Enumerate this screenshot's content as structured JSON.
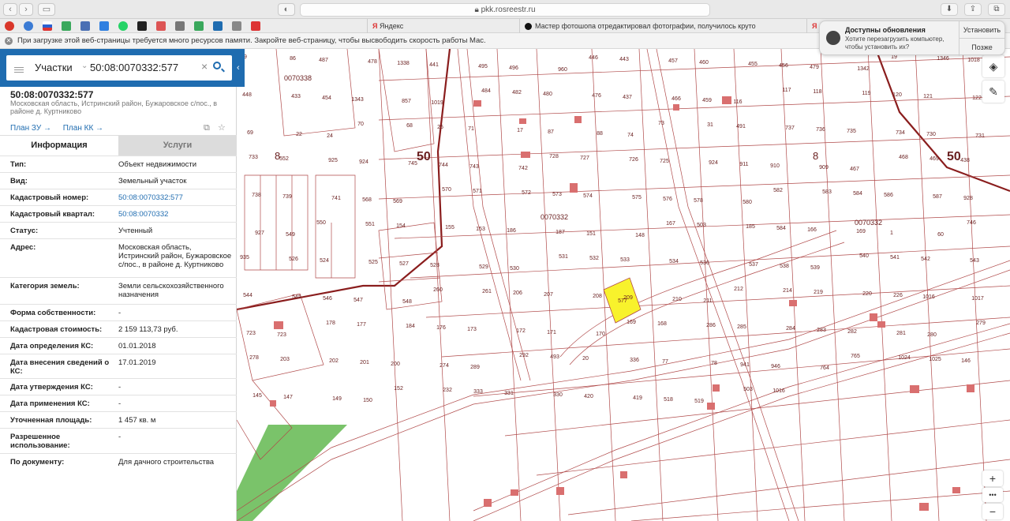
{
  "browser": {
    "url": "pkk.rosreestr.ru",
    "tabs": [
      {
        "label": "Яндекс"
      },
      {
        "label": "Мастер фотошопа отредактировал фотографии, получилось круто | Кин..."
      },
      {
        "label": "Я"
      }
    ],
    "memory_warning": "При загрузке этой веб-страницы требуется много ресурсов памяти. Закройте веб-страницу, чтобы высвободить скорость работы Mac."
  },
  "notification": {
    "title": "Доступны обновления",
    "text": "Хотите перезагрузить компьютер, чтобы установить их?",
    "install": "Установить",
    "later": "Позже"
  },
  "search": {
    "category": "Участки",
    "value": "50:08:0070332:577"
  },
  "object": {
    "cadastral": "50:08:0070332:577",
    "address_short": "Московская область, Истринский район, Бужаровское с/пос., в районе д. Куртниково",
    "plan_zu": "План ЗУ →",
    "plan_kk": "План КК →"
  },
  "tabs": {
    "info": "Информация",
    "services": "Услуги"
  },
  "fields": [
    {
      "key": "Тип:",
      "value": "Объект недвижимости"
    },
    {
      "key": "Вид:",
      "value": "Земельный участок"
    },
    {
      "key": "Кадастровый номер:",
      "value": "50:08:0070332:577",
      "link": true
    },
    {
      "key": "Кадастровый квартал:",
      "value": "50:08:0070332",
      "link": true
    },
    {
      "key": "Статус:",
      "value": "Учтенный"
    },
    {
      "key": "Адрес:",
      "value": "Московская область, Истринский район, Бужаровское с/пос., в районе д. Куртниково"
    },
    {
      "key": "Категория земель:",
      "value": "Земли сельскохозяйственного назначения"
    },
    {
      "key": "Форма собственности:",
      "value": "-"
    },
    {
      "key": "Кадастровая стоимость:",
      "value": "2 159 113,73 руб."
    },
    {
      "key": "Дата определения КС:",
      "value": "01.01.2018"
    },
    {
      "key": "Дата внесения сведений о КС:",
      "value": "17.01.2019"
    },
    {
      "key": "Дата утверждения КС:",
      "value": "-"
    },
    {
      "key": "Дата применения КС:",
      "value": "-"
    },
    {
      "key": "Уточненная площадь:",
      "value": "1 457 кв. м"
    },
    {
      "key": "Разрешенное использование:",
      "value": "-"
    },
    {
      "key": "По документу:",
      "value": "Для дачного строительства"
    }
  ],
  "map": {
    "selected_parcel": "577",
    "big_labels": [
      "50",
      "8",
      "50",
      "8"
    ],
    "quarter_labels": [
      "0070338",
      "0070332",
      "0070332"
    ],
    "parcels": [
      "89",
      "86",
      "487",
      "478",
      "1338",
      "441",
      "495",
      "496",
      "960",
      "446",
      "443",
      "457",
      "460",
      "455",
      "456",
      "479",
      "1342",
      "19",
      "1346",
      "1018",
      "448",
      "433",
      "454",
      "1343",
      "857",
      "1019",
      "484",
      "482",
      "480",
      "476",
      "437",
      "466",
      "459",
      "116",
      "117",
      "118",
      "119",
      "120",
      "121",
      "122",
      "69",
      "22",
      "24",
      "70",
      "68",
      "25",
      "71",
      "17",
      "87",
      "88",
      "74",
      "73",
      "31",
      "491",
      "737",
      "736",
      "735",
      "734",
      "730",
      "731",
      "733",
      "552",
      "925",
      "924",
      "745",
      "744",
      "743",
      "742",
      "728",
      "727",
      "726",
      "725",
      "924",
      "911",
      "910",
      "909",
      "467",
      "468",
      "469",
      "438",
      "738",
      "739",
      "741",
      "568",
      "569",
      "570",
      "571",
      "572",
      "573",
      "574",
      "575",
      "576",
      "578",
      "580",
      "582",
      "583",
      "584",
      "586",
      "587",
      "928",
      "927",
      "549",
      "550",
      "551",
      "154",
      "155",
      "153",
      "186",
      "187",
      "151",
      "148",
      "167",
      "503",
      "185",
      "584",
      "166",
      "169",
      "1",
      "60",
      "746",
      "935",
      "526",
      "524",
      "525",
      "527",
      "528",
      "529",
      "530",
      "531",
      "532",
      "533",
      "534",
      "536",
      "537",
      "538",
      "539",
      "540",
      "541",
      "542",
      "543",
      "544",
      "545",
      "546",
      "547",
      "548",
      "260",
      "261",
      "206",
      "207",
      "208",
      "209",
      "210",
      "211",
      "212",
      "214",
      "219",
      "220",
      "226",
      "1016",
      "1017",
      "723",
      "723",
      "178",
      "177",
      "184",
      "176",
      "173",
      "172",
      "171",
      "170",
      "169",
      "168",
      "286",
      "285",
      "284",
      "283",
      "282",
      "281",
      "280",
      "279",
      "278",
      "203",
      "202",
      "201",
      "200",
      "274",
      "289",
      "292",
      "493",
      "20",
      "336",
      "77",
      "78",
      "941",
      "946",
      "764",
      "765",
      "1024",
      "1025",
      "146",
      "145",
      "147",
      "149",
      "150",
      "152",
      "232",
      "333",
      "331",
      "330",
      "420",
      "419",
      "518",
      "519",
      "503",
      "1016"
    ]
  },
  "controls": {
    "zoom_in": "+",
    "zoom_out": "−",
    "more": "•••"
  }
}
